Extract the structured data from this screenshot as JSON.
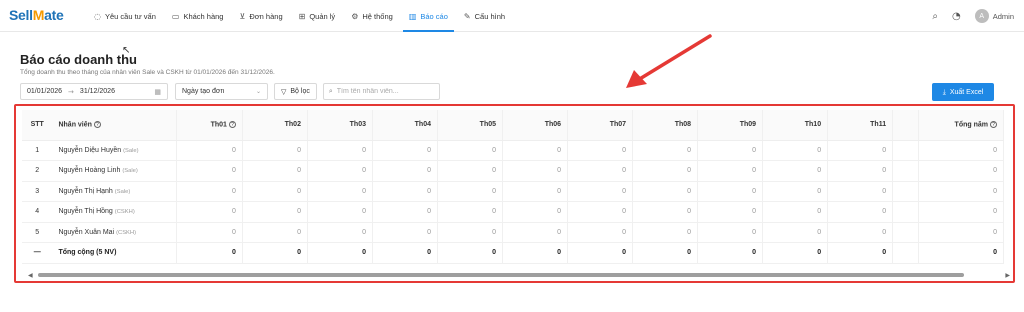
{
  "app": {
    "logo_main": "Sell",
    "logo_accent": "M",
    "logo_rest": "ate"
  },
  "nav": {
    "items": [
      {
        "label": "Yêu cầu tư vấn",
        "icon": "chat-icon"
      },
      {
        "label": "Khách hàng",
        "icon": "contact-card-icon"
      },
      {
        "label": "Đơn hàng",
        "icon": "cart-icon"
      },
      {
        "label": "Quản lý",
        "icon": "grid-icon"
      },
      {
        "label": "Hệ thống",
        "icon": "gear-icon"
      },
      {
        "label": "Báo cáo",
        "icon": "bar-chart-icon",
        "active": true
      },
      {
        "label": "Cấu hình",
        "icon": "wrench-icon"
      }
    ],
    "user_initial": "A",
    "user_name": "Admin"
  },
  "page": {
    "title": "Báo cáo doanh thu",
    "subtitle": "Tổng doanh thu theo tháng của nhân viên Sale và CSKH từ 01/01/2026 đến 31/12/2026."
  },
  "filters": {
    "date_from": "01/01/2026",
    "date_to": "31/12/2026",
    "date_type": "Ngày tạo đơn",
    "filter_label": "Bộ lọc",
    "search_placeholder": "Tìm tên nhân viên...",
    "export_label": "Xuất Excel"
  },
  "table": {
    "headers": {
      "stt": "STT",
      "name": "Nhân viên",
      "months": [
        "Th01",
        "Th02",
        "Th03",
        "Th04",
        "Th05",
        "Th06",
        "Th07",
        "Th08",
        "Th09",
        "Th10",
        "Th11"
      ],
      "total": "Tổng năm"
    },
    "rows": [
      {
        "stt": "1",
        "name": "Nguyễn Diệu Huyền",
        "role": "(Sale)",
        "values": [
          "0",
          "0",
          "0",
          "0",
          "0",
          "0",
          "0",
          "0",
          "0",
          "0",
          "0"
        ],
        "total": "0"
      },
      {
        "stt": "2",
        "name": "Nguyễn Hoàng Linh",
        "role": "(Sale)",
        "values": [
          "0",
          "0",
          "0",
          "0",
          "0",
          "0",
          "0",
          "0",
          "0",
          "0",
          "0"
        ],
        "total": "0"
      },
      {
        "stt": "3",
        "name": "Nguyễn Thị Hạnh",
        "role": "(Sale)",
        "values": [
          "0",
          "0",
          "0",
          "0",
          "0",
          "0",
          "0",
          "0",
          "0",
          "0",
          "0"
        ],
        "total": "0"
      },
      {
        "stt": "4",
        "name": "Nguyễn Thị Hồng",
        "role": "(CSKH)",
        "values": [
          "0",
          "0",
          "0",
          "0",
          "0",
          "0",
          "0",
          "0",
          "0",
          "0",
          "0"
        ],
        "total": "0"
      },
      {
        "stt": "5",
        "name": "Nguyễn Xuân Mai",
        "role": "(CSKH)",
        "values": [
          "0",
          "0",
          "0",
          "0",
          "0",
          "0",
          "0",
          "0",
          "0",
          "0",
          "0"
        ],
        "total": "0"
      }
    ],
    "total_row": {
      "stt": "—",
      "name": "Tổng cộng (5 NV)",
      "values": [
        "0",
        "0",
        "0",
        "0",
        "0",
        "0",
        "0",
        "0",
        "0",
        "0",
        "0"
      ],
      "total": "0"
    }
  },
  "colors": {
    "accent": "#1e88e5",
    "logo_blue": "#1f73b7",
    "logo_orange": "#f59a00",
    "annotation_red": "#e53935"
  }
}
